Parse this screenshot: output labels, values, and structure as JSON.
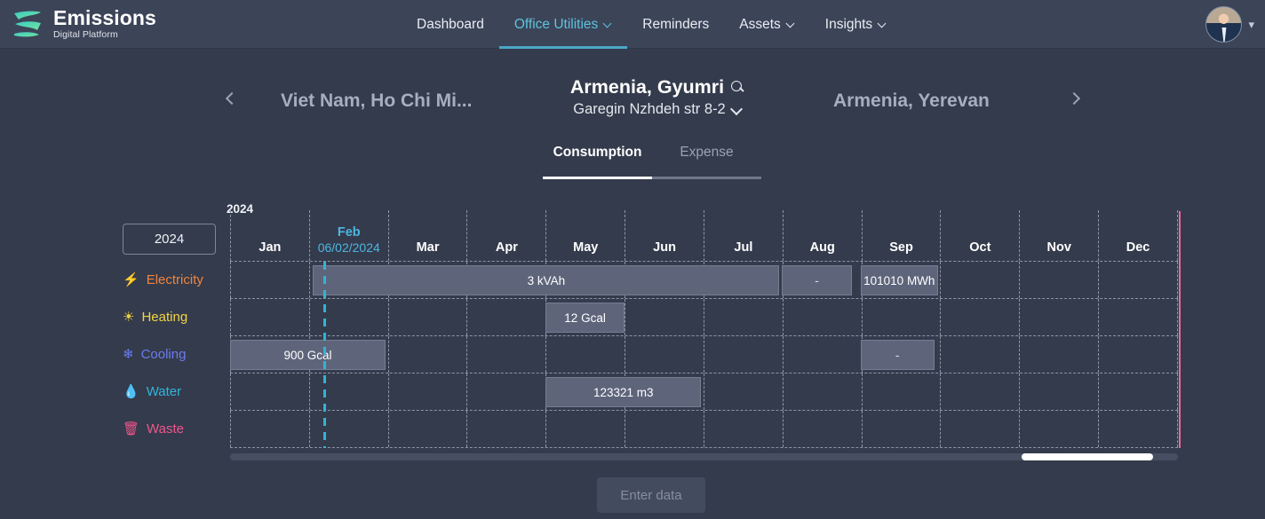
{
  "brand": {
    "title": "Emissions",
    "subtitle": "Digital Platform",
    "logo_icon": "emissions-leaf-logo"
  },
  "nav": {
    "items": [
      {
        "label": "Dashboard",
        "has_caret": false,
        "active": false
      },
      {
        "label": "Office Utilities",
        "has_caret": true,
        "active": true
      },
      {
        "label": "Reminders",
        "has_caret": false,
        "active": false
      },
      {
        "label": "Assets",
        "has_caret": true,
        "active": false
      },
      {
        "label": "Insights",
        "has_caret": true,
        "active": false
      }
    ],
    "avatar_icon": "user-avatar",
    "avatar_caret_icon": "chevron-down-icon"
  },
  "location": {
    "prev_icon": "chevron-left-icon",
    "next_icon": "chevron-right-icon",
    "prev_label": "Viet Nam, Ho Chi Mi...",
    "current_title": "Armenia, Gyumri",
    "current_address": "Garegin Nzhdeh str 8-2",
    "next_label": "Armenia, Yerevan",
    "search_icon": "search-icon",
    "address_caret_icon": "chevron-down-icon"
  },
  "tabs": [
    {
      "label": "Consumption",
      "active": true
    },
    {
      "label": "Expense",
      "active": false
    }
  ],
  "timeline": {
    "year_label": "2024",
    "year_button": "2024",
    "months": [
      {
        "name": "Jan",
        "date": "",
        "current": false
      },
      {
        "name": "Feb",
        "date": "06/02/2024",
        "current": true
      },
      {
        "name": "Mar",
        "date": "",
        "current": false
      },
      {
        "name": "Apr",
        "date": "",
        "current": false
      },
      {
        "name": "May",
        "date": "",
        "current": false
      },
      {
        "name": "Jun",
        "date": "",
        "current": false
      },
      {
        "name": "Jul",
        "date": "",
        "current": false
      },
      {
        "name": "Aug",
        "date": "",
        "current": false
      },
      {
        "name": "Sep",
        "date": "",
        "current": false
      },
      {
        "name": "Oct",
        "date": "",
        "current": false
      },
      {
        "name": "Nov",
        "date": "",
        "current": false
      },
      {
        "name": "Dec",
        "date": "",
        "current": false
      }
    ],
    "rows": [
      {
        "label": "Electricity",
        "icon": "lightning-bolt-icon",
        "icon_glyph": "⚡",
        "color": "#f0843c",
        "bars": [
          {
            "value": "3 kVAh",
            "left_pct": 8.75,
            "width_pct": 49.2
          },
          {
            "value": "-",
            "left_pct": 58.2,
            "width_pct": 7.4
          },
          {
            "value": "101010 MWh",
            "left_pct": 66.5,
            "width_pct": 8.2
          }
        ]
      },
      {
        "label": "Heating",
        "icon": "sun-icon",
        "icon_glyph": "☀",
        "color": "#f2d544",
        "bars": [
          {
            "value": "12 Gcal",
            "left_pct": 33.3,
            "width_pct": 8.3
          }
        ]
      },
      {
        "label": "Cooling",
        "icon": "snowflake-icon",
        "icon_glyph": "❄",
        "color": "#6b7cf0",
        "bars": [
          {
            "value": "900 Gcal",
            "left_pct": 0.0,
            "width_pct": 16.4
          },
          {
            "value": "-",
            "left_pct": 66.5,
            "width_pct": 7.8
          }
        ]
      },
      {
        "label": "Water",
        "icon": "water-drop-icon",
        "icon_glyph": "💧",
        "color": "#2fb7dc",
        "bars": [
          {
            "value": "123321 m3",
            "left_pct": 33.3,
            "width_pct": 16.4
          }
        ]
      },
      {
        "label": "Waste",
        "icon": "trash-bin-icon",
        "icon_glyph": "🗑",
        "color": "#f0568c",
        "bars": []
      }
    ],
    "today_marker_pct": 9.8,
    "today_marker_color": "#2fb5d4",
    "period_end_color": "#e86a9a",
    "scroll_thumb_left_pct": 83.5,
    "scroll_thumb_width_pct": 13.9
  },
  "footer": {
    "enter_data_label": "Enter data"
  },
  "colors": {
    "page_bg": "#343b4c",
    "topbar_bg": "#3c4458",
    "accent": "#5ec3de",
    "bar_fill": "#5e657b",
    "grid_line": "#8d95a6"
  }
}
